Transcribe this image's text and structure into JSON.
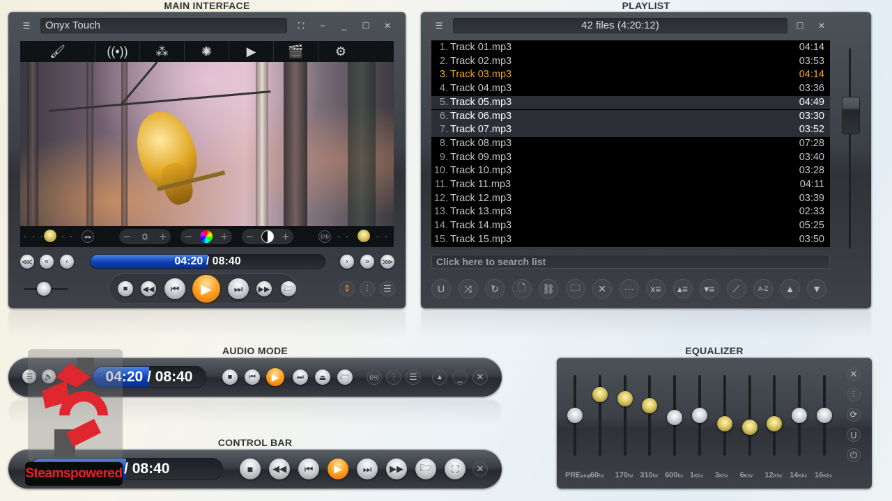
{
  "sections": {
    "main": "MAIN INTERFACE",
    "playlist": "PLAYLIST",
    "audio": "AUDIO MODE",
    "controlbar": "CONTROL BAR",
    "equalizer": "EQUALIZER"
  },
  "main": {
    "title": "Onyx Touch",
    "toolbar": [
      "skin-brush",
      "broadcast",
      "color-balls",
      "visualization",
      "play-folder",
      "clapperboard",
      "settings"
    ],
    "time": "04:20 / 08:40",
    "progress_fraction": 0.5,
    "volume_fraction": 0.45
  },
  "playlist": {
    "header": "42 files (4:20:12)",
    "search_placeholder": "Click here to search list",
    "scroll_fraction": 0.3,
    "tracks": [
      {
        "num": "1.",
        "name": "Track 01.mp3",
        "dur": "04:14",
        "state": ""
      },
      {
        "num": "2.",
        "name": "Track 02.mp3",
        "dur": "03:53",
        "state": ""
      },
      {
        "num": "3.",
        "name": "Track 03.mp3",
        "dur": "04:14",
        "state": "playing"
      },
      {
        "num": "4.",
        "name": "Track 04.mp3",
        "dur": "03:36",
        "state": ""
      },
      {
        "num": "5.",
        "name": "Track 05.mp3",
        "dur": "04:49",
        "state": "selected"
      },
      {
        "num": "6.",
        "name": "Track 06.mp3",
        "dur": "03:30",
        "state": "selected"
      },
      {
        "num": "7.",
        "name": "Track 07.mp3",
        "dur": "03:52",
        "state": "selected"
      },
      {
        "num": "8.",
        "name": "Track 08.mp3",
        "dur": "07:28",
        "state": ""
      },
      {
        "num": "9.",
        "name": "Track 09.mp3",
        "dur": "03:40",
        "state": ""
      },
      {
        "num": "10.",
        "name": "Track 10.mp3",
        "dur": "03:28",
        "state": ""
      },
      {
        "num": "11.",
        "name": "Track 11.mp3",
        "dur": "04:11",
        "state": ""
      },
      {
        "num": "12.",
        "name": "Track 12.mp3",
        "dur": "03:39",
        "state": ""
      },
      {
        "num": "13.",
        "name": "Track 13.mp3",
        "dur": "02:33",
        "state": ""
      },
      {
        "num": "14.",
        "name": "Track 14.mp3",
        "dur": "05:25",
        "state": ""
      },
      {
        "num": "15.",
        "name": "Track 15.mp3",
        "dur": "03:50",
        "state": ""
      }
    ],
    "tools": [
      {
        "name": "magnet-icon",
        "glyph": "U"
      },
      {
        "name": "shuffle-icon",
        "glyph": "⤨"
      },
      {
        "name": "repeat-icon",
        "glyph": "↻"
      },
      {
        "name": "add-file-icon",
        "glyph": "🗋"
      },
      {
        "name": "add-url-icon",
        "glyph": "⛓"
      },
      {
        "name": "add-folder-icon",
        "glyph": "🗀"
      },
      {
        "name": "remove-file-icon",
        "glyph": "✕"
      },
      {
        "name": "misc-icon",
        "glyph": "⋯"
      },
      {
        "name": "clear-list-icon",
        "glyph": "x≡"
      },
      {
        "name": "move-up-list-icon",
        "glyph": "▴≡"
      },
      {
        "name": "move-down-list-icon",
        "glyph": "▾≡"
      },
      {
        "name": "magic-wand-icon",
        "glyph": "⟋"
      },
      {
        "name": "sort-az-icon",
        "glyph": "A-Z"
      },
      {
        "name": "scroll-up-icon",
        "glyph": "▲"
      },
      {
        "name": "scroll-down-icon",
        "glyph": "▼"
      }
    ]
  },
  "audio": {
    "time": "04:20 / 08:40",
    "progress_fraction": 0.5
  },
  "controlbar": {
    "time": "04:20 / 08:40",
    "time_visible": "0 / 08:40",
    "progress_fraction": 0.5
  },
  "equalizer": {
    "bands": [
      {
        "label": "PRE",
        "unit": "amp",
        "value": 0.0,
        "color": "silver"
      },
      {
        "label": "60",
        "unit": "hz",
        "value": 0.52,
        "color": "gold"
      },
      {
        "label": "170",
        "unit": "hz",
        "value": 0.42,
        "color": "gold"
      },
      {
        "label": "310",
        "unit": "hz",
        "value": 0.24,
        "color": "gold"
      },
      {
        "label": "600",
        "unit": "hz",
        "value": -0.06,
        "color": "silver"
      },
      {
        "label": "1",
        "unit": "Khz",
        "value": 0.0,
        "color": "silver"
      },
      {
        "label": "3",
        "unit": "Khz",
        "value": -0.2,
        "color": "gold"
      },
      {
        "label": "6",
        "unit": "Khz",
        "value": -0.3,
        "color": "gold"
      },
      {
        "label": "12",
        "unit": "Khz",
        "value": -0.2,
        "color": "gold"
      },
      {
        "label": "14",
        "unit": "Khz",
        "value": 0.0,
        "color": "silver"
      },
      {
        "label": "16",
        "unit": "Khz",
        "value": 0.0,
        "color": "silver"
      }
    ]
  },
  "watermark": {
    "text": "Steamspowered"
  }
}
